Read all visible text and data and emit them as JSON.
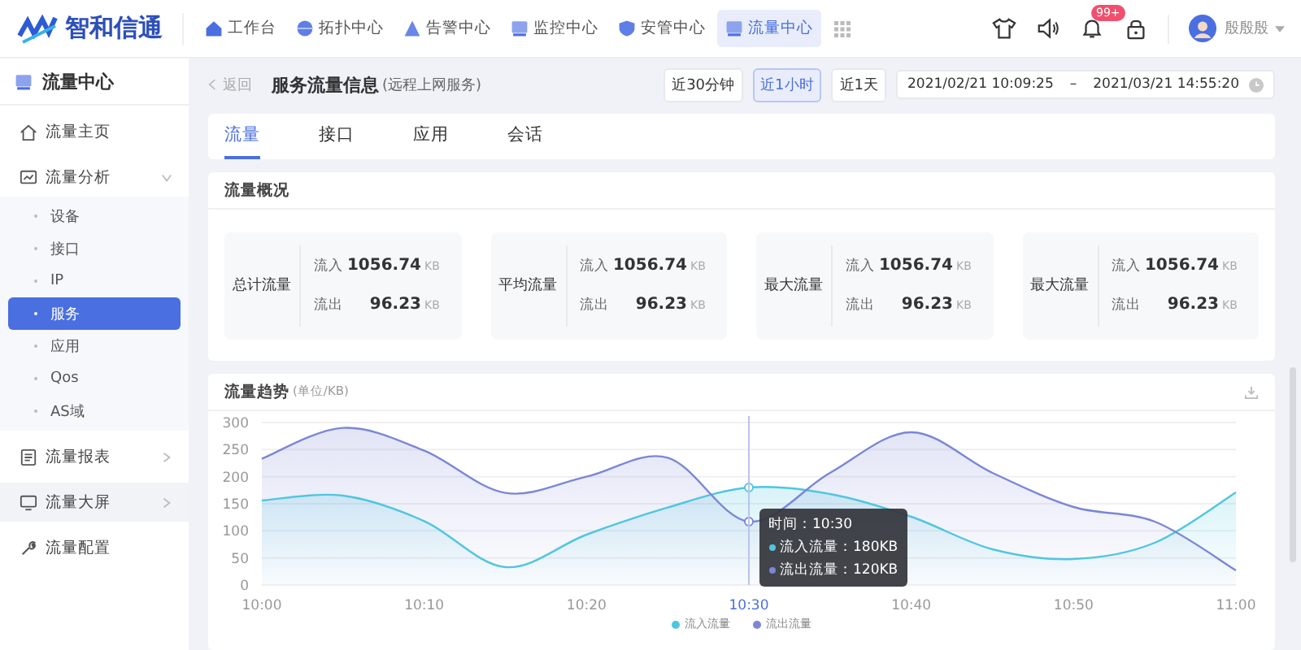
{
  "header": {
    "brand": "智和信通",
    "nav": [
      {
        "label": "工作台",
        "selected": false
      },
      {
        "label": "拓扑中心",
        "selected": false
      },
      {
        "label": "告警中心",
        "selected": false
      },
      {
        "label": "监控中心",
        "selected": false
      },
      {
        "label": "安管中心",
        "selected": false
      },
      {
        "label": "流量中心",
        "selected": true
      }
    ],
    "notification_badge": "99+",
    "user_name": "殷殷殷"
  },
  "sidebar": {
    "title": "流量中心",
    "items": [
      {
        "label": "流量主页",
        "highlighted": false
      },
      {
        "label": "流量分析",
        "highlighted": false,
        "expanded": true,
        "children": [
          {
            "label": "设备",
            "selected": false
          },
          {
            "label": "接口",
            "selected": false
          },
          {
            "label": "IP",
            "selected": false
          },
          {
            "label": "服务",
            "selected": true
          },
          {
            "label": "应用",
            "selected": false
          },
          {
            "label": "Qos",
            "selected": false
          },
          {
            "label": "AS域",
            "selected": false
          }
        ]
      },
      {
        "label": "流量报表",
        "highlighted": false,
        "expanded": false
      },
      {
        "label": "流量大屏",
        "highlighted": true,
        "expanded": false
      },
      {
        "label": "流量配置",
        "highlighted": false
      }
    ]
  },
  "page": {
    "back": "返回",
    "title": "服务流量信息",
    "subtitle": "(远程上网服务)",
    "ranges": [
      {
        "label": "近30分钟",
        "selected": false
      },
      {
        "label": "近1小时",
        "selected": true
      },
      {
        "label": "近1天",
        "selected": false
      }
    ],
    "date_start": "2021/02/21 10:09:25",
    "date_separator": "–",
    "date_end": "2021/03/21 14:55:20"
  },
  "tabs": [
    {
      "label": "流量",
      "selected": true
    },
    {
      "label": "接口",
      "selected": false
    },
    {
      "label": "应用",
      "selected": false
    },
    {
      "label": "会话",
      "selected": false
    }
  ],
  "overview": {
    "title": "流量概况",
    "cards": [
      {
        "label": "总计流量",
        "in_label": "流入",
        "in_value": "1056.74",
        "in_unit": "KB",
        "out_label": "流出",
        "out_value": "96.23",
        "out_unit": "KB"
      },
      {
        "label": "平均流量",
        "in_label": "流入",
        "in_value": "1056.74",
        "in_unit": "KB",
        "out_label": "流出",
        "out_value": "96.23",
        "out_unit": "KB"
      },
      {
        "label": "最大流量",
        "in_label": "流入",
        "in_value": "1056.74",
        "in_unit": "KB",
        "out_label": "流出",
        "out_value": "96.23",
        "out_unit": "KB"
      },
      {
        "label": "最大流量",
        "in_label": "流入",
        "in_value": "1056.74",
        "in_unit": "KB",
        "out_label": "流出",
        "out_value": "96.23",
        "out_unit": "KB"
      }
    ]
  },
  "trend": {
    "title": "流量趋势",
    "unit": "(单位/KB)",
    "tooltip": {
      "time": "时间：10:30",
      "lines": [
        "流入流量：180KB",
        "流出流量：120KB"
      ]
    },
    "chart_data": {
      "type": "area",
      "categories": [
        "10:00",
        null,
        "10:10",
        null,
        "10:20",
        null,
        "10:30",
        null,
        "10:40",
        null,
        "10:50",
        null,
        "11:00"
      ],
      "series": [
        {
          "name": "流入流量",
          "color": "#4fc6e0",
          "values": [
            156,
            165,
            118,
            33,
            93,
            143,
            180,
            168,
            126,
            66,
            48,
            78,
            171
          ]
        },
        {
          "name": "流出流量",
          "color": "#7b86d6",
          "values": [
            233,
            290,
            248,
            170,
            200,
            235,
            117,
            207,
            282,
            207,
            144,
            117,
            27
          ]
        }
      ],
      "ylim": [
        0,
        300
      ],
      "yticks": [
        0,
        50,
        100,
        150,
        200,
        250,
        300
      ],
      "grid": true
    }
  }
}
